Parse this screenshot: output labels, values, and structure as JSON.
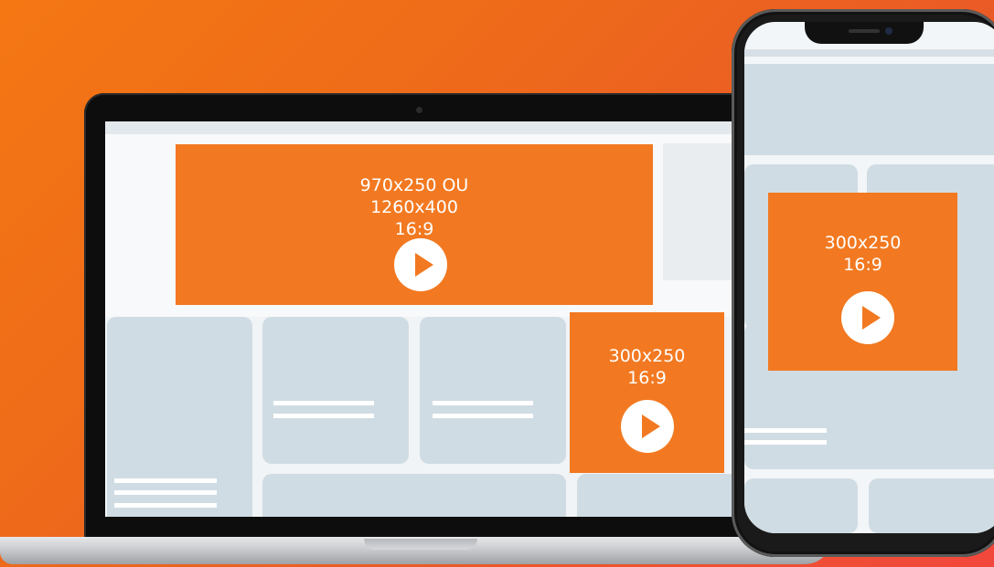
{
  "laptop": {
    "ad_leaderboard": {
      "line1": "970x250 OU",
      "line2": "1260x400",
      "line3": "16:9"
    },
    "ad_medium_rectangle": {
      "line1": "300x250",
      "line2": "16:9"
    }
  },
  "phone": {
    "ad_medium_rectangle": {
      "line1": "300x250",
      "line2": "16:9"
    }
  },
  "colors": {
    "ad_orange": "#f27921",
    "placeholder_card": "#d0dce3",
    "background_gradient_start": "#f47713",
    "background_gradient_end": "#f2473c"
  },
  "icons": [
    "play-icon"
  ]
}
